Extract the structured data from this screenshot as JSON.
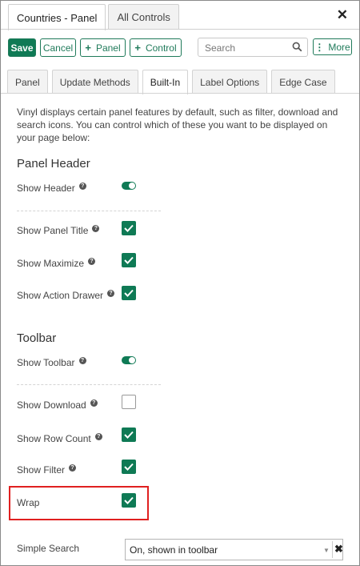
{
  "window": {
    "tabs": [
      "Countries - Panel",
      "All Controls"
    ],
    "close_icon": "close-icon"
  },
  "toolbar": {
    "save_label": "Save",
    "cancel_label": "Cancel",
    "add_panel_label": "Panel",
    "add_control_label": "Control",
    "search_placeholder": "Search",
    "more_label": "More"
  },
  "subtabs": [
    "Panel",
    "Update Methods",
    "Built-In",
    "Label Options",
    "Edge Case"
  ],
  "content": {
    "intro": "Vinyl displays certain panel features by default, such as filter, download and search icons. You can control which of these you want to be displayed on your page below:",
    "panel_header": {
      "title": "Panel Header",
      "show_header": "Show Header",
      "show_panel_title": "Show Panel Title",
      "show_maximize": "Show Maximize",
      "show_action_drawer": "Show Action Drawer"
    },
    "toolbar_section": {
      "title": "Toolbar",
      "show_toolbar": "Show Toolbar",
      "show_download": "Show Download",
      "show_row_count": "Show Row Count",
      "show_filter": "Show Filter",
      "wrap": "Wrap"
    },
    "simple_search": {
      "label": "Simple Search",
      "value": "On, shown in toolbar"
    }
  },
  "colors": {
    "accent": "#0f7a55",
    "highlight_border": "#e02020"
  }
}
